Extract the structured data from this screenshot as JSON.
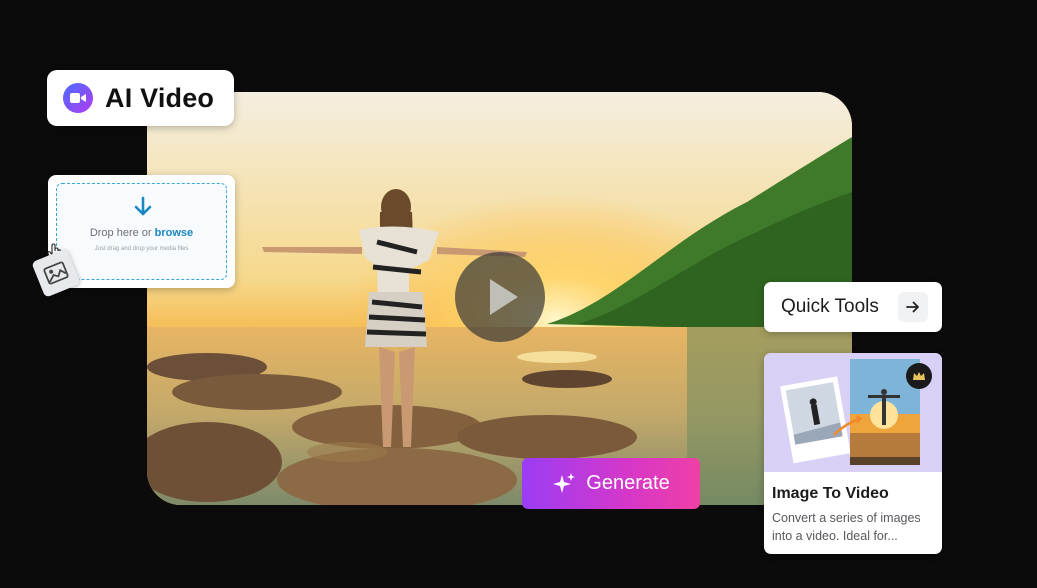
{
  "badge": {
    "title": "AI Video",
    "icon": "video-camera-icon"
  },
  "upload": {
    "drop_text": "Drop here or",
    "browse_label": "browse",
    "hint": "Just drag and drop your media files"
  },
  "player": {
    "icon": "play-icon"
  },
  "generate": {
    "label": "Generate",
    "icon": "sparkle-icon"
  },
  "quick_tools": {
    "label": "Quick Tools",
    "icon": "arrow-right-icon"
  },
  "feature_card": {
    "title": "Image To Video",
    "description": "Convert a series of images into a video. Ideal for...",
    "icon": "crown-icon"
  },
  "colors": {
    "generate_gradient_start": "#9b3df5",
    "generate_gradient_end": "#f03fa6",
    "browse_link": "#1a86c4",
    "background": "#0b0b0c"
  }
}
